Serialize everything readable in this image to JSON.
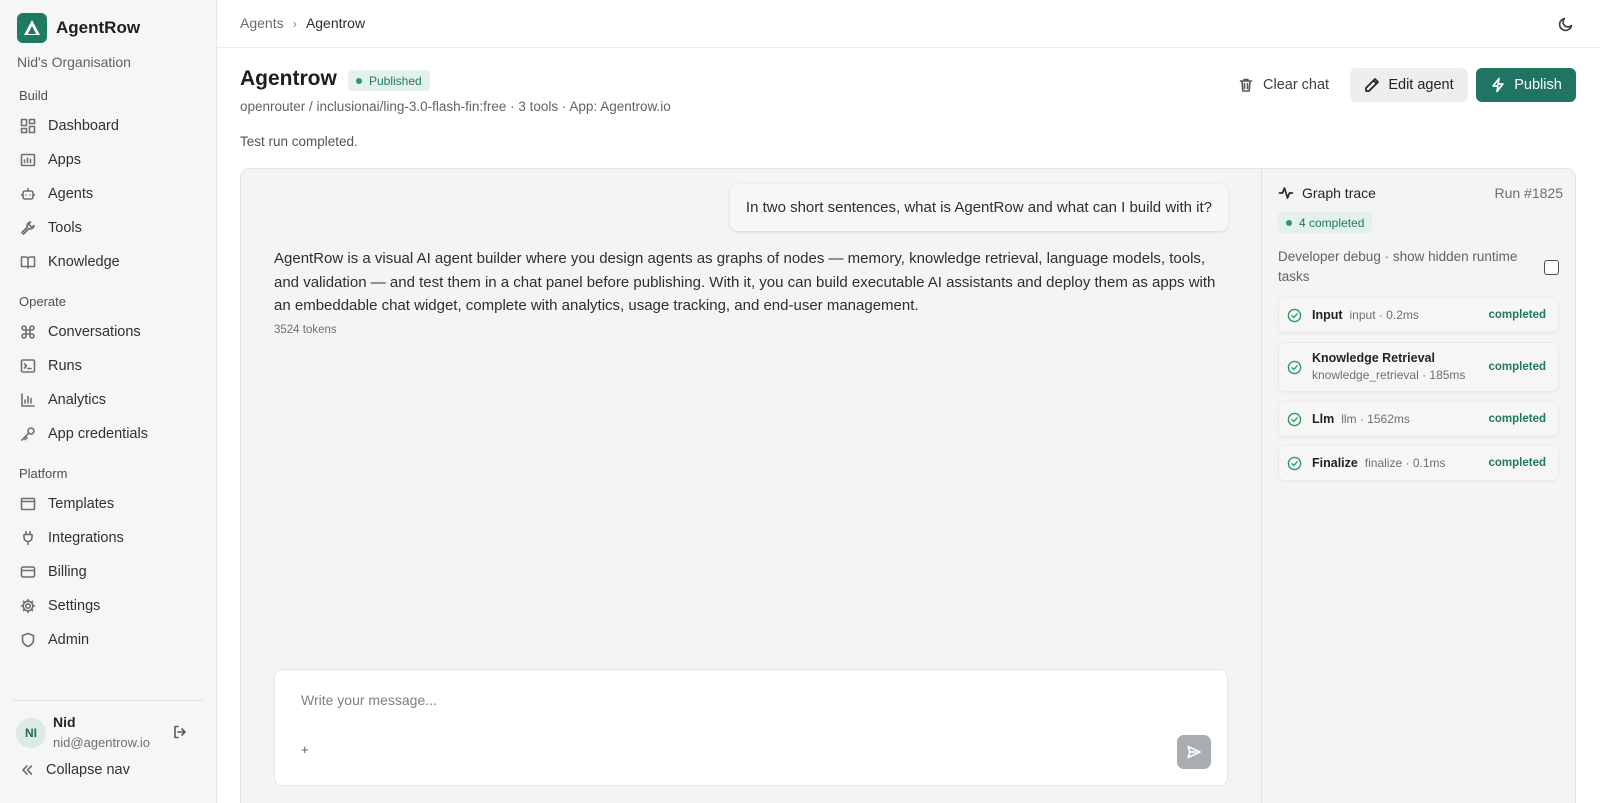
{
  "brand": {
    "name": "AgentRow",
    "org": "Nid's Organisation"
  },
  "nav": {
    "sections": [
      {
        "label": "Build",
        "items": [
          {
            "label": "Dashboard",
            "icon": "dashboard-icon"
          },
          {
            "label": "Apps",
            "icon": "apps-icon"
          },
          {
            "label": "Agents",
            "icon": "agents-icon"
          },
          {
            "label": "Tools",
            "icon": "tools-icon"
          },
          {
            "label": "Knowledge",
            "icon": "book-icon"
          }
        ]
      },
      {
        "label": "Operate",
        "items": [
          {
            "label": "Conversations",
            "icon": "command-icon"
          },
          {
            "label": "Runs",
            "icon": "terminal-icon"
          },
          {
            "label": "Analytics",
            "icon": "bar-chart-icon"
          },
          {
            "label": "App credentials",
            "icon": "key-icon"
          }
        ]
      },
      {
        "label": "Platform",
        "items": [
          {
            "label": "Templates",
            "icon": "template-icon"
          },
          {
            "label": "Integrations",
            "icon": "plug-icon"
          },
          {
            "label": "Billing",
            "icon": "credit-card-icon"
          },
          {
            "label": "Settings",
            "icon": "gear-icon"
          },
          {
            "label": "Admin",
            "icon": "shield-icon"
          }
        ]
      }
    ]
  },
  "user": {
    "initials": "NI",
    "name": "Nid",
    "email": "nid@agentrow.io"
  },
  "collapse_label": "Collapse nav",
  "breadcrumb": {
    "parent": "Agents",
    "current": "Agentrow"
  },
  "agent": {
    "title": "Agentrow",
    "status": "Published",
    "meta": "openrouter / inclusionai/ling-3.0-flash-fin:free · 3 tools · App: Agentrow.io",
    "run_status": "Test run completed."
  },
  "actions": {
    "clear": "Clear chat",
    "edit": "Edit agent",
    "publish": "Publish"
  },
  "chat": {
    "user_message": "In two short sentences, what is AgentRow and what can I build with it?",
    "assistant_message": "AgentRow is a visual AI agent builder where you design agents as graphs of nodes — memory, knowledge retrieval, language models, tools, and validation — and test them in a chat panel before publishing. With it, you can build executable AI assistants and deploy them as apps with an embeddable chat widget, complete with analytics, usage tracking, and end-user management.",
    "tokens": "3524 tokens",
    "placeholder": "Write your message...",
    "attach": "+"
  },
  "trace": {
    "title": "Graph trace",
    "run_id": "Run #1825",
    "completed": "4 completed",
    "debug_label": "Developer debug · show hidden runtime tasks",
    "nodes": [
      {
        "name": "Input",
        "info": "input · 0.2ms",
        "status": "completed"
      },
      {
        "name": "Knowledge Retrieval",
        "info": "knowledge_retrieval · 185ms",
        "status": "completed"
      },
      {
        "name": "Llm",
        "info": "llm · 1562ms",
        "status": "completed"
      },
      {
        "name": "Finalize",
        "info": "finalize · 0.1ms",
        "status": "completed"
      }
    ]
  },
  "colors": {
    "accent": "#1f7562",
    "success": "#1f7a58",
    "badge_bg": "#e3f1ea"
  }
}
